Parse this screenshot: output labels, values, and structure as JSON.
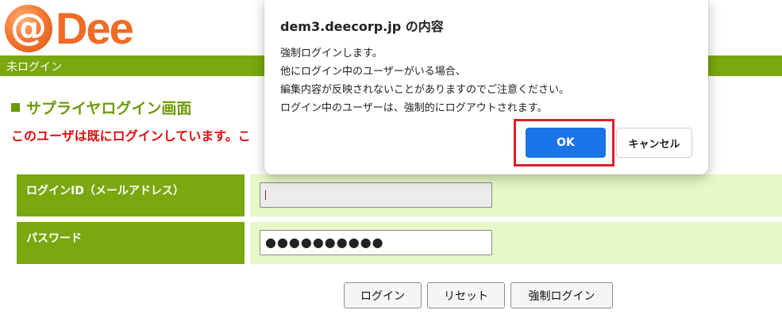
{
  "header": {
    "logo_at": "@",
    "logo_text": "Dee"
  },
  "status_bar": {
    "text": "未ログイン"
  },
  "page": {
    "title": "サプライヤログイン画面",
    "warning": "このユーザは既にログインしています。こ"
  },
  "form": {
    "login_id_label": "ログインID（メールアドレス）",
    "password_label": "パスワード",
    "password_value": "●●●●●●●●●●"
  },
  "buttons": {
    "login": "ログイン",
    "reset": "リセット",
    "force_login": "強制ログイン"
  },
  "dialog": {
    "title": "dem3.deecorp.jp の内容",
    "lines": [
      "強制ログインします。",
      "他にログイン中のユーザーがいる場合、",
      "編集内容が反映されないことがありますのでご注意ください。",
      "ログイン中のユーザーは、強制的にログアウトされます。"
    ],
    "ok": "OK",
    "cancel": "キャンセル"
  },
  "colors": {
    "brand_green": "#7aa80e",
    "brand_orange": "#f06b24",
    "warning_red": "#e00d0d",
    "ok_blue": "#1a73e8",
    "highlight_red": "#e21c2a"
  }
}
